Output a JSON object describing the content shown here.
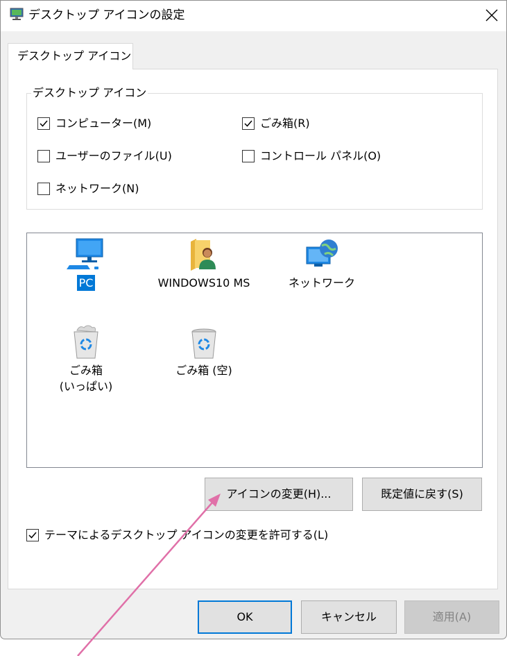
{
  "window": {
    "title": "デスクトップ アイコンの設定"
  },
  "tab": {
    "label": "デスクトップ アイコン"
  },
  "group": {
    "legend": "デスクトップ アイコン",
    "checkboxes": [
      {
        "label": "コンピューター(M)",
        "checked": true
      },
      {
        "label": "ごみ箱(R)",
        "checked": true
      },
      {
        "label": "ユーザーのファイル(U)",
        "checked": false
      },
      {
        "label": "コントロール パネル(O)",
        "checked": false
      },
      {
        "label": "ネットワーク(N)",
        "checked": false
      }
    ]
  },
  "icons": [
    {
      "label": "PC",
      "icon": "computer-icon",
      "selected": true
    },
    {
      "label": "WINDOWS10 MS",
      "icon": "user-folder-icon"
    },
    {
      "label": "ネットワーク",
      "icon": "network-icon"
    },
    {
      "label": "ごみ箱",
      "label2": "(いっぱい)",
      "icon": "recycle-bin-full-icon"
    },
    {
      "label": "ごみ箱 (空)",
      "icon": "recycle-bin-empty-icon"
    }
  ],
  "buttons": {
    "change_icon": "アイコンの変更(H)...",
    "restore_default": "既定値に戻す(S)",
    "ok": "OK",
    "cancel": "キャンセル",
    "apply": "適用(A)"
  },
  "theme_checkbox": {
    "label": "テーマによるデスクトップ アイコンの変更を許可する(L)",
    "checked": true
  },
  "colors": {
    "accent": "#0078d7",
    "arrow": "#e070a8"
  }
}
